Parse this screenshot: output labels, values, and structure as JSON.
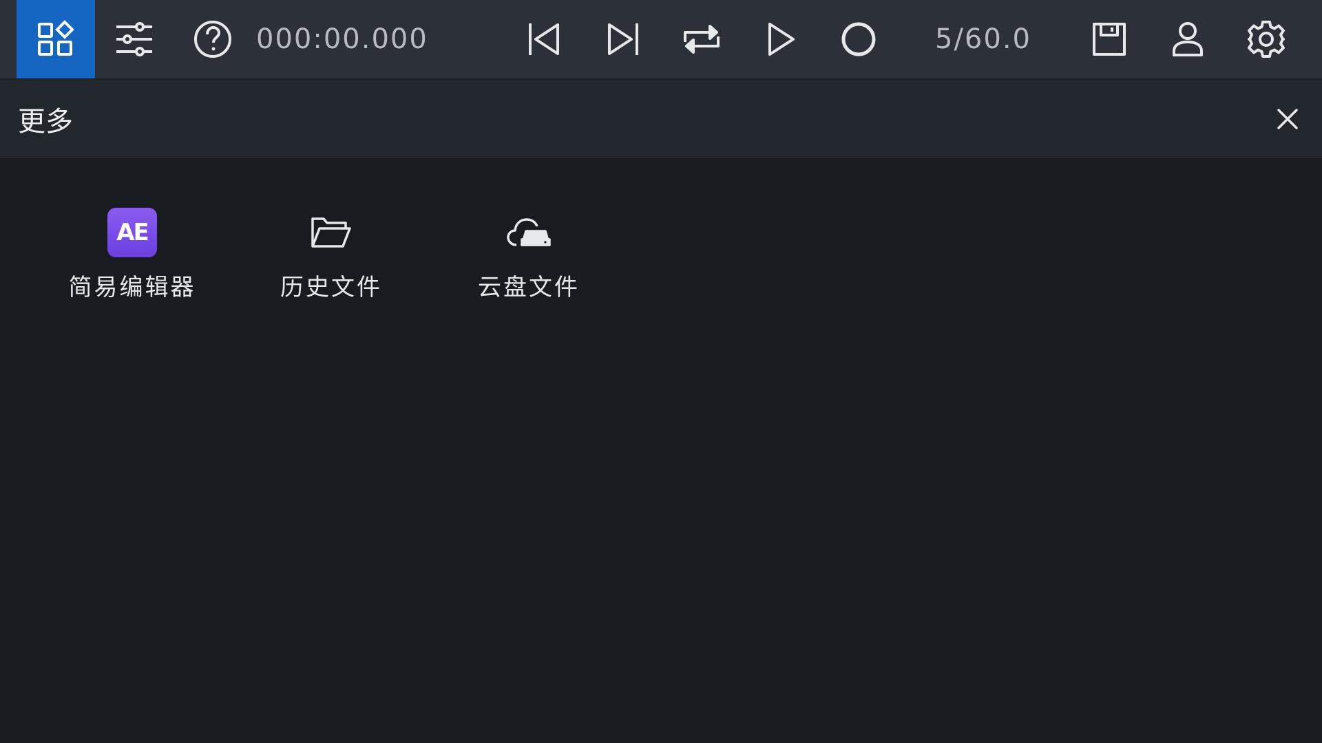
{
  "toolbar": {
    "timecode": "000:00.000",
    "counter": "5/60.0",
    "buttons": [
      {
        "name": "apps-icon",
        "active": true
      },
      {
        "name": "sliders-icon"
      },
      {
        "name": "help-icon"
      },
      {
        "name": "skip-start-icon"
      },
      {
        "name": "skip-end-icon"
      },
      {
        "name": "repeat-icon"
      },
      {
        "name": "play-icon"
      },
      {
        "name": "record-icon"
      },
      {
        "name": "save-icon"
      },
      {
        "name": "user-icon"
      },
      {
        "name": "settings-icon"
      }
    ]
  },
  "panel": {
    "title": "更多",
    "close_icon": "close-icon"
  },
  "apps": [
    {
      "label": "简易编辑器",
      "icon": "ae-app-icon",
      "badge_text": "AE",
      "badge_color": "#7a4fe8"
    },
    {
      "label": "历史文件",
      "icon": "folder-open-icon"
    },
    {
      "label": "云盘文件",
      "icon": "cloud-drive-icon"
    }
  ],
  "colors": {
    "accent": "#1466c2",
    "toolbar_bg": "#2c3139",
    "panel_header_bg": "#22262d",
    "content_bg": "#181b20"
  }
}
